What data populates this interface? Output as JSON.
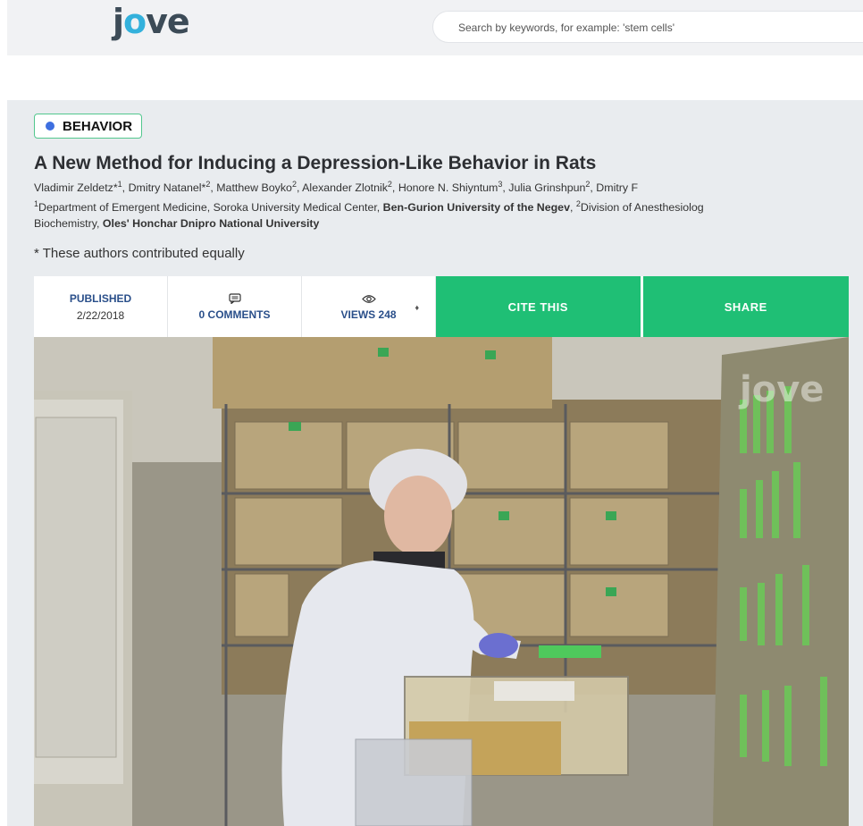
{
  "header": {
    "logo": {
      "prefix": "j",
      "middle": "o",
      "suffix": "ve"
    },
    "search_placeholder": "Search by keywords, for example: 'stem cells'"
  },
  "article": {
    "category": "BEHAVIOR",
    "title": "A New Method for Inducing a Depression-Like Behavior in Rats",
    "authors": [
      {
        "name": "Vladimir Zeldetz*",
        "sup": "1",
        "sep": ", "
      },
      {
        "name": "Dmitry Natanel*",
        "sup": "2",
        "sep": ", "
      },
      {
        "name": "Matthew Boyko",
        "sup": "2",
        "sep": ", "
      },
      {
        "name": "Alexander Zlotnik",
        "sup": "2",
        "sep": ", "
      },
      {
        "name": "Honore N. Shiyntum",
        "sup": "3",
        "sep": ", "
      },
      {
        "name": "Julia Grinshpun",
        "sup": "2",
        "sep": ", "
      },
      {
        "name": "Dmitry F",
        "sup": "",
        "sep": ""
      }
    ],
    "affiliations": {
      "a1_sup": "1",
      "a1_dept": "Department of Emergent Medicine, Soroka University Medical Center, ",
      "a1_univ": "Ben-Gurion University of the Negev",
      "a1_sep": ", ",
      "a2_sup": "2",
      "a2_dept": "Division of Anesthesiolog",
      "line2_pre": "Biochemistry, ",
      "line2_univ": "Oles' Honchar Dnipro National University"
    },
    "equal_note": "* These authors contributed equally"
  },
  "stats": {
    "published_label": "PUBLISHED",
    "published_date": "2/22/2018",
    "comments_label": "0 COMMENTS",
    "views_label": "VIEWS 248",
    "views_caret": "♦",
    "cite_label": "CITE THIS",
    "share_label": "SHARE"
  },
  "video": {
    "watermark": "jove"
  },
  "colors": {
    "accent_green": "#1fbf75",
    "badge_dot": "#3e6fe0",
    "link_blue": "#2a4f8a",
    "logo_o": "#33b1dc"
  }
}
